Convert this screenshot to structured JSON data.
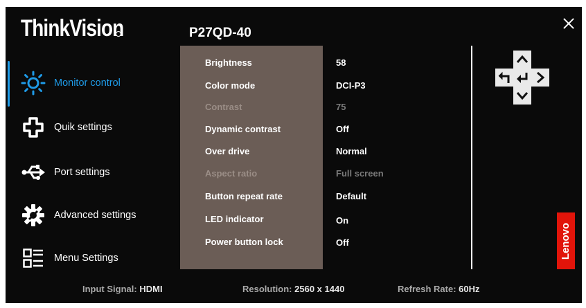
{
  "brand": {
    "logo_text": "ThinkVision",
    "vendor_text": "Lenovo"
  },
  "header": {
    "model": "P27QD-40"
  },
  "sidebar": {
    "items": [
      {
        "label": "Monitor control",
        "icon": "brightness-sun-icon",
        "active": true
      },
      {
        "label": "Quik settings",
        "icon": "puzzle-cross-icon"
      },
      {
        "label": "Port settings",
        "icon": "usb-icon"
      },
      {
        "label": "Advanced settings",
        "icon": "gear-icon"
      },
      {
        "label": "Menu Settings",
        "icon": "menu-grid-icon"
      }
    ]
  },
  "settings": [
    {
      "label": "Brightness",
      "value": "58",
      "enabled": true
    },
    {
      "label": "Color mode",
      "value": "DCI-P3",
      "enabled": true
    },
    {
      "label": "Contrast",
      "value": "75",
      "enabled": false
    },
    {
      "label": "Dynamic contrast",
      "value": "Off",
      "enabled": true
    },
    {
      "label": "Over drive",
      "value": "Normal",
      "enabled": true
    },
    {
      "label": "Aspect ratio",
      "value": "Full screen",
      "enabled": false
    },
    {
      "label": "Button repeat rate",
      "value": "Default",
      "enabled": true
    },
    {
      "label": "LED indicator",
      "value": "On",
      "enabled": true
    },
    {
      "label": "Power button lock",
      "value": "Off",
      "enabled": true
    }
  ],
  "status": {
    "input_label": "Input Signal:",
    "input_value": "HDMI",
    "resolution_label": "Resolution:",
    "resolution_value": "2560 x 1440",
    "refresh_label": "Refresh Rate:",
    "refresh_value": "60Hz"
  },
  "colors": {
    "accent": "#1e9be8",
    "panel": "#6b5d56",
    "lenovo_red": "#e1140a"
  }
}
